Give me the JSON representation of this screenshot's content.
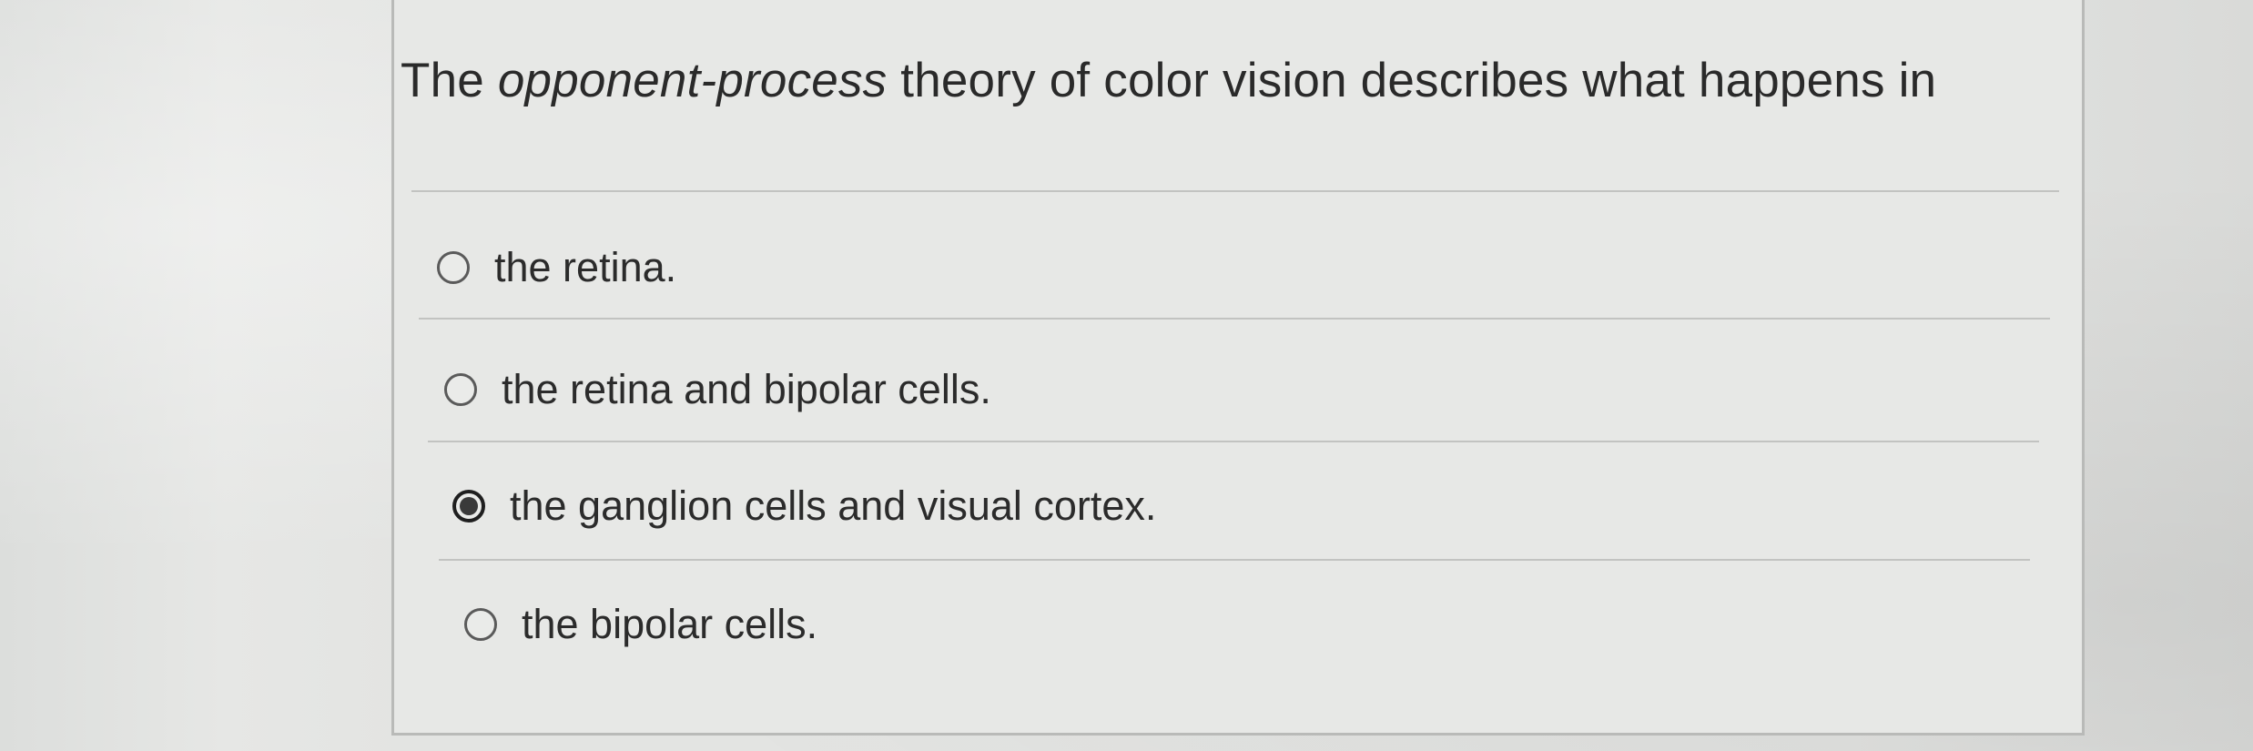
{
  "question": {
    "text_before": "The ",
    "text_italic": "opponent-process",
    "text_after": " theory of color vision describes what happens in"
  },
  "options": [
    {
      "label": "the retina.",
      "selected": false
    },
    {
      "label": "the retina and bipolar cells.",
      "selected": false
    },
    {
      "label": "the ganglion cells and visual cortex.",
      "selected": true
    },
    {
      "label": "the bipolar cells.",
      "selected": false
    }
  ]
}
